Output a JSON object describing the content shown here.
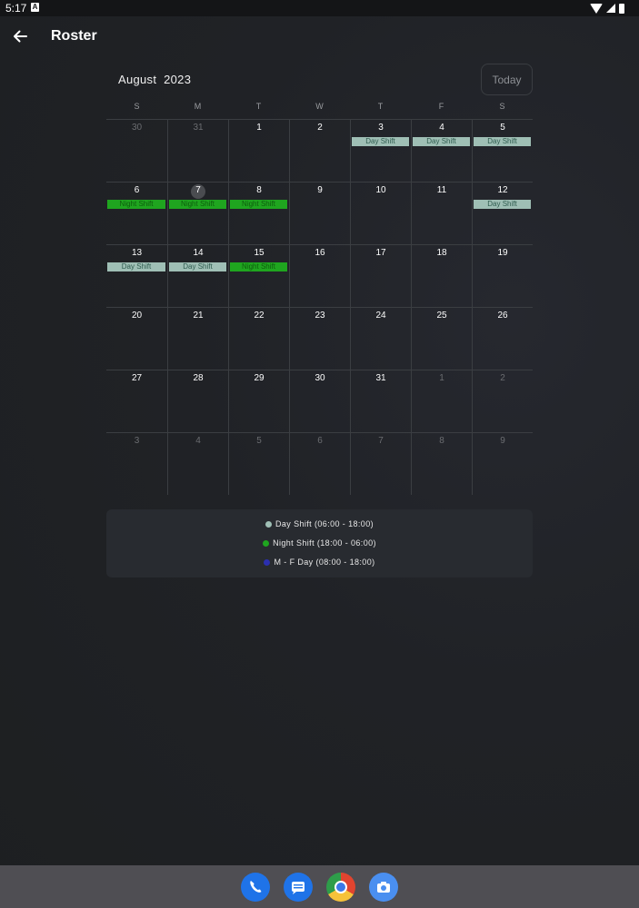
{
  "status_bar": {
    "time": "5:17",
    "notification_glyph": "A",
    "icons": [
      "wifi-icon",
      "signal-icon",
      "battery-icon"
    ]
  },
  "app_bar": {
    "title": "Roster",
    "back_icon": "arrow-left-icon"
  },
  "calendar": {
    "month": "August",
    "year": "2023",
    "today_label": "Today",
    "weekdays": [
      "S",
      "M",
      "T",
      "W",
      "T",
      "F",
      "S"
    ],
    "current_day": "7",
    "weeks": [
      [
        {
          "d": "30",
          "out": true
        },
        {
          "d": "31",
          "out": true
        },
        {
          "d": "1"
        },
        {
          "d": "2"
        },
        {
          "d": "3",
          "event": "Day Shift",
          "type": "day"
        },
        {
          "d": "4",
          "event": "Day Shift",
          "type": "day"
        },
        {
          "d": "5",
          "event": "Day Shift",
          "type": "day"
        }
      ],
      [
        {
          "d": "6",
          "event": "Night Shift",
          "type": "night"
        },
        {
          "d": "7",
          "event": "Night Shift",
          "type": "night",
          "today": true
        },
        {
          "d": "8",
          "event": "Night Shift",
          "type": "night"
        },
        {
          "d": "9"
        },
        {
          "d": "10"
        },
        {
          "d": "11"
        },
        {
          "d": "12",
          "event": "Day Shift",
          "type": "day"
        }
      ],
      [
        {
          "d": "13",
          "event": "Day Shift",
          "type": "day"
        },
        {
          "d": "14",
          "event": "Day Shift",
          "type": "day"
        },
        {
          "d": "15",
          "event": "Night Shift",
          "type": "night"
        },
        {
          "d": "16"
        },
        {
          "d": "17"
        },
        {
          "d": "18"
        },
        {
          "d": "19"
        }
      ],
      [
        {
          "d": "20"
        },
        {
          "d": "21"
        },
        {
          "d": "22"
        },
        {
          "d": "23"
        },
        {
          "d": "24"
        },
        {
          "d": "25"
        },
        {
          "d": "26"
        }
      ],
      [
        {
          "d": "27"
        },
        {
          "d": "28"
        },
        {
          "d": "29"
        },
        {
          "d": "30"
        },
        {
          "d": "31"
        },
        {
          "d": "1",
          "out": true
        },
        {
          "d": "2",
          "out": true
        }
      ],
      [
        {
          "d": "3",
          "out": true
        },
        {
          "d": "4",
          "out": true
        },
        {
          "d": "5",
          "out": true
        },
        {
          "d": "6",
          "out": true
        },
        {
          "d": "7",
          "out": true
        },
        {
          "d": "8",
          "out": true
        },
        {
          "d": "9",
          "out": true
        }
      ]
    ]
  },
  "legend": {
    "items": [
      {
        "label": "Day Shift (06:00 - 18:00)",
        "color": "#9fbfb5"
      },
      {
        "label": "Night Shift (18:00 - 06:00)",
        "color": "#1fa51f"
      },
      {
        "label": "M - F Day (08:00 - 18:00)",
        "color": "#2b2fb0"
      }
    ]
  },
  "colors": {
    "day_shift": "#9fbfb5",
    "night_shift": "#1fa51f",
    "mf_day": "#2b2fb0"
  },
  "dock": {
    "apps": [
      "phone-icon",
      "messages-icon",
      "chrome-icon",
      "camera-icon"
    ]
  }
}
